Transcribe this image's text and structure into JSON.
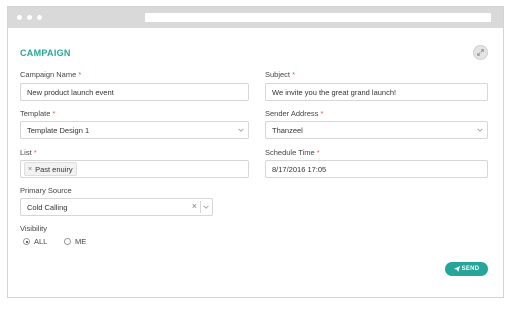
{
  "section": {
    "title": "CAMPAIGN"
  },
  "campaign_name": {
    "label": "Campaign Name",
    "required_mark": "*",
    "value": "New product launch event"
  },
  "subject": {
    "label": "Subject",
    "required_mark": "*",
    "value": "We invite you the great grand launch!"
  },
  "template": {
    "label": "Template",
    "required_mark": "*",
    "value": "Template Design 1"
  },
  "sender_address": {
    "label": "Sender Address",
    "required_mark": "*",
    "value": "Thanzeel"
  },
  "list": {
    "label": "List",
    "required_mark": "*",
    "tags": [
      "Past enuiry"
    ],
    "tag_remove": "×"
  },
  "schedule_time": {
    "label": "Schedule Time",
    "required_mark": "*",
    "value": "8/17/2016 17:05"
  },
  "primary_source": {
    "label": "Primary Source",
    "value": "Cold Calling",
    "clear": "×"
  },
  "visibility": {
    "label": "Visibility",
    "options": [
      "ALL",
      "ME"
    ],
    "selected": "ALL"
  },
  "send_button": {
    "label": "SEND"
  },
  "colors": {
    "accent": "#26a69a",
    "required": "#e05050",
    "titlebar": "#d9d9d9"
  },
  "icons": {
    "expand": "expand-icon",
    "send": "paper-plane-icon",
    "dropdown": "chevron-down-icon"
  }
}
